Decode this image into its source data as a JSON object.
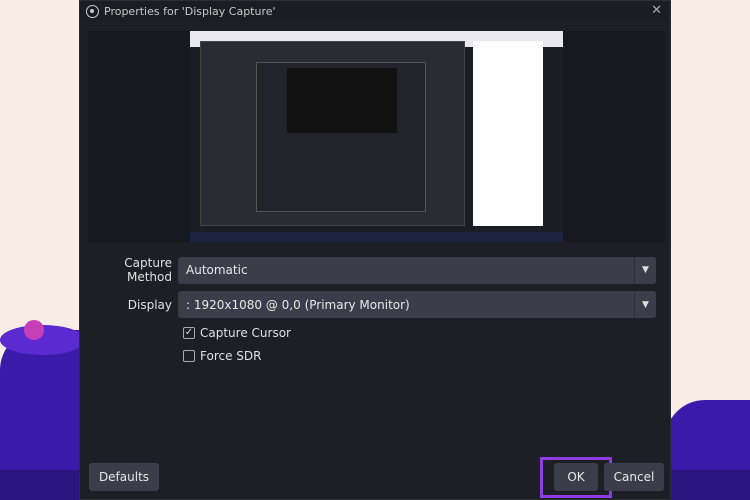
{
  "window": {
    "title": "Properties for 'Display Capture'"
  },
  "form": {
    "capture_method": {
      "label": "Capture Method",
      "value": "Automatic"
    },
    "display": {
      "label": "Display",
      "value": ": 1920x1080 @ 0,0 (Primary Monitor)"
    },
    "capture_cursor": {
      "label": "Capture Cursor",
      "checked": true
    },
    "force_sdr": {
      "label": "Force SDR",
      "checked": false
    }
  },
  "buttons": {
    "defaults": "Defaults",
    "ok": "OK",
    "cancel": "Cancel"
  },
  "colors": {
    "highlight": "#8d3ee0",
    "dialog_bg": "#1e1f26",
    "field_bg": "#3b3d4a"
  }
}
